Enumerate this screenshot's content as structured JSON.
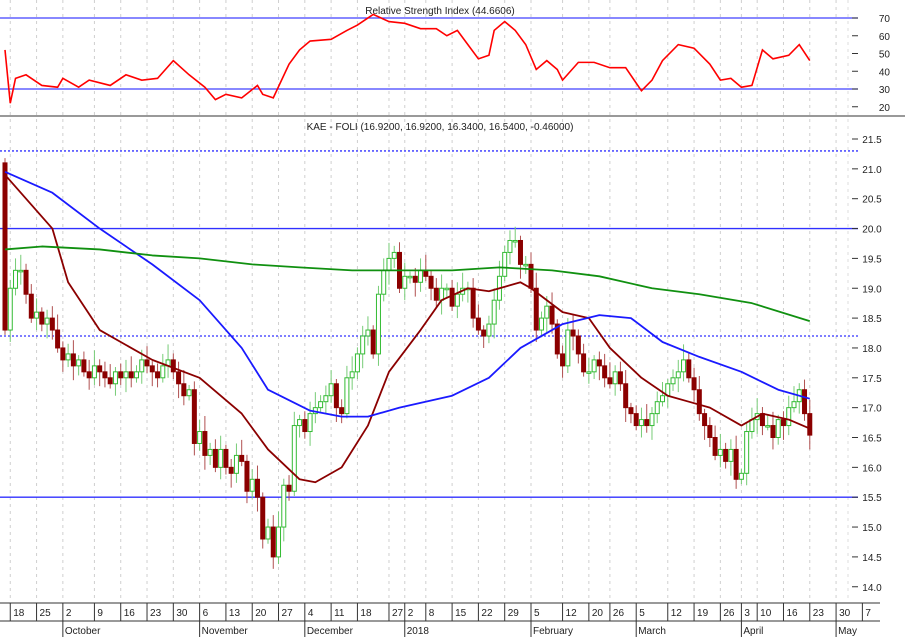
{
  "chart_data": {
    "type": "candlestick",
    "rsi_panel": {
      "title": "Relative Strength Index (44.6606)",
      "ylim": [
        15,
        78
      ],
      "ticks": [
        20,
        30,
        40,
        50,
        60,
        70
      ],
      "levels": [
        30,
        70
      ],
      "color": "#ff0000",
      "series": [
        [
          0,
          52
        ],
        [
          1,
          22
        ],
        [
          2,
          36
        ],
        [
          4,
          38
        ],
        [
          7,
          32
        ],
        [
          10,
          31
        ],
        [
          11,
          36
        ],
        [
          14,
          31
        ],
        [
          16,
          35
        ],
        [
          20,
          32
        ],
        [
          23,
          38
        ],
        [
          26,
          35
        ],
        [
          29,
          36
        ],
        [
          32,
          46
        ],
        [
          35,
          38
        ],
        [
          38,
          31
        ],
        [
          40,
          24
        ],
        [
          42,
          27
        ],
        [
          45,
          25
        ],
        [
          48,
          32
        ],
        [
          49,
          27
        ],
        [
          51,
          25
        ],
        [
          54,
          44
        ],
        [
          56,
          52
        ],
        [
          58,
          57
        ],
        [
          62,
          58
        ],
        [
          65,
          63
        ],
        [
          67,
          66
        ],
        [
          70,
          72
        ],
        [
          73,
          68
        ],
        [
          76,
          67
        ],
        [
          79,
          64
        ],
        [
          82,
          64
        ],
        [
          84,
          60
        ],
        [
          86,
          63
        ],
        [
          88,
          55
        ],
        [
          90,
          47
        ],
        [
          92,
          49
        ],
        [
          93,
          63
        ],
        [
          95,
          68
        ],
        [
          97,
          63
        ],
        [
          99,
          55
        ],
        [
          101,
          41
        ],
        [
          103,
          46
        ],
        [
          105,
          41
        ],
        [
          106,
          35
        ],
        [
          109,
          45
        ],
        [
          112,
          45
        ],
        [
          115,
          42
        ],
        [
          118,
          42
        ],
        [
          121,
          29
        ],
        [
          123,
          35
        ],
        [
          125,
          46
        ],
        [
          128,
          55
        ],
        [
          131,
          53
        ],
        [
          134,
          44
        ],
        [
          136,
          35
        ],
        [
          138,
          36
        ],
        [
          140,
          31
        ],
        [
          142,
          32
        ],
        [
          144,
          52
        ],
        [
          146,
          47
        ],
        [
          149,
          49
        ],
        [
          151,
          55
        ],
        [
          153,
          46
        ]
      ]
    },
    "price_panel": {
      "title": "KAE - FOLI (16.9200, 16.9200, 16.3400, 16.5400, -0.46000)",
      "ylim": [
        13.75,
        21.85
      ],
      "ticks": [
        "14.0",
        "14.5",
        "15.0",
        "15.5",
        "16.0",
        "16.5",
        "17.0",
        "17.5",
        "18.0",
        "18.5",
        "19.0",
        "19.5",
        "20.0",
        "20.5",
        "21.0",
        "21.5"
      ],
      "first_open": 21.1,
      "up_color": "#33bb33",
      "down_color": "#8b0000",
      "closes": [
        18.3,
        19.0,
        19.3,
        19.3,
        18.9,
        18.5,
        18.6,
        18.4,
        18.5,
        18.3,
        18.0,
        17.8,
        17.9,
        17.7,
        17.8,
        17.6,
        17.5,
        17.7,
        17.6,
        17.5,
        17.4,
        17.6,
        17.5,
        17.6,
        17.5,
        17.6,
        17.8,
        17.7,
        17.6,
        17.5,
        17.7,
        17.8,
        17.6,
        17.4,
        17.2,
        17.3,
        16.4,
        16.6,
        16.2,
        16.3,
        16.0,
        16.3,
        16.0,
        15.9,
        16.2,
        16.1,
        15.6,
        15.8,
        15.5,
        14.8,
        15.0,
        14.5,
        15.0,
        15.7,
        15.6,
        16.7,
        16.8,
        16.6,
        16.9,
        17.0,
        17.1,
        17.2,
        17.4,
        17.0,
        16.9,
        17.5,
        17.6,
        17.9,
        18.2,
        18.3,
        17.9,
        18.9,
        19.3,
        19.5,
        19.6,
        19.0,
        19.2,
        19.2,
        19.1,
        19.3,
        19.2,
        19.0,
        18.8,
        19.0,
        19.0,
        18.7,
        18.9,
        19.0,
        19.0,
        18.5,
        18.3,
        18.2,
        18.4,
        18.8,
        19.2,
        19.6,
        19.8,
        19.8,
        19.4,
        19.4,
        19.0,
        18.3,
        18.5,
        18.7,
        18.4,
        17.9,
        17.7,
        18.3,
        18.2,
        17.9,
        17.6,
        17.6,
        17.8,
        17.7,
        17.5,
        17.4,
        17.6,
        17.4,
        17.0,
        16.9,
        16.7,
        16.8,
        16.7,
        16.9,
        17.1,
        17.2,
        17.4,
        17.5,
        17.6,
        17.8,
        17.5,
        17.3,
        16.9,
        16.7,
        16.5,
        16.2,
        16.3,
        16.1,
        16.3,
        15.8,
        15.9,
        16.6,
        16.8,
        16.9,
        16.7,
        16.7,
        16.5,
        16.8,
        16.7,
        17.0,
        17.1,
        17.3,
        16.9,
        16.54
      ],
      "levels": [
        {
          "value": 21.3,
          "style": "dotted"
        },
        {
          "value": 20.0,
          "style": "solid"
        },
        {
          "value": 18.2,
          "style": "dotted"
        },
        {
          "value": 15.5,
          "style": "solid"
        }
      ],
      "moving_averages": [
        {
          "name": "short-ma",
          "color": "#8b0000",
          "points": [
            [
              0,
              20.9
            ],
            [
              9,
              20.0
            ],
            [
              12,
              19.1
            ],
            [
              18,
              18.3
            ],
            [
              22,
              18.1
            ],
            [
              28,
              17.8
            ],
            [
              37,
              17.5
            ],
            [
              45,
              16.9
            ],
            [
              50,
              16.3
            ],
            [
              56,
              15.8
            ],
            [
              59,
              15.75
            ],
            [
              64,
              16.0
            ],
            [
              69,
              16.7
            ],
            [
              73,
              17.6
            ],
            [
              79,
              18.3
            ],
            [
              83,
              18.8
            ],
            [
              88,
              19.0
            ],
            [
              92,
              18.95
            ],
            [
              98,
              19.1
            ],
            [
              100,
              19.0
            ],
            [
              106,
              18.6
            ],
            [
              111,
              18.5
            ],
            [
              115,
              18.0
            ],
            [
              121,
              17.5
            ],
            [
              126,
              17.2
            ],
            [
              130,
              17.1
            ],
            [
              134,
              17.0
            ],
            [
              140,
              16.7
            ],
            [
              144,
              16.9
            ],
            [
              149,
              16.8
            ],
            [
              153,
              16.65
            ]
          ]
        },
        {
          "name": "medium-ma",
          "color": "#1a1aff",
          "points": [
            [
              0,
              20.95
            ],
            [
              9,
              20.6
            ],
            [
              18,
              20.0
            ],
            [
              28,
              19.4
            ],
            [
              37,
              18.8
            ],
            [
              45,
              18.0
            ],
            [
              50,
              17.3
            ],
            [
              58,
              16.95
            ],
            [
              64,
              16.85
            ],
            [
              69,
              16.85
            ],
            [
              75,
              17.0
            ],
            [
              85,
              17.2
            ],
            [
              92,
              17.5
            ],
            [
              98,
              18.0
            ],
            [
              106,
              18.4
            ],
            [
              113,
              18.55
            ],
            [
              119,
              18.5
            ],
            [
              125,
              18.1
            ],
            [
              132,
              17.85
            ],
            [
              140,
              17.6
            ],
            [
              147,
              17.3
            ],
            [
              153,
              17.15
            ]
          ]
        },
        {
          "name": "long-ma",
          "color": "#109010",
          "points": [
            [
              0,
              19.65
            ],
            [
              7,
              19.7
            ],
            [
              18,
              19.65
            ],
            [
              28,
              19.55
            ],
            [
              37,
              19.5
            ],
            [
              47,
              19.4
            ],
            [
              56,
              19.35
            ],
            [
              66,
              19.3
            ],
            [
              75,
              19.3
            ],
            [
              85,
              19.3
            ],
            [
              94,
              19.35
            ],
            [
              104,
              19.3
            ],
            [
              113,
              19.2
            ],
            [
              123,
              19.0
            ],
            [
              132,
              18.9
            ],
            [
              142,
              18.75
            ],
            [
              153,
              18.45
            ]
          ]
        }
      ]
    },
    "x_axis": {
      "day_ticks": [
        [
          1,
          "18"
        ],
        [
          6,
          "25"
        ],
        [
          11,
          "2"
        ],
        [
          17,
          "9"
        ],
        [
          22,
          "16"
        ],
        [
          27,
          "23"
        ],
        [
          32,
          "30"
        ],
        [
          37,
          "6"
        ],
        [
          42,
          "13"
        ],
        [
          47,
          "20"
        ],
        [
          52,
          "27"
        ],
        [
          57,
          "4"
        ],
        [
          62,
          "11"
        ],
        [
          67,
          "18"
        ],
        [
          73,
          "27"
        ],
        [
          76,
          "2"
        ],
        [
          80,
          "8"
        ],
        [
          85,
          "15"
        ],
        [
          90,
          "22"
        ],
        [
          95,
          "29"
        ],
        [
          100,
          "5"
        ],
        [
          106,
          "12"
        ],
        [
          111,
          "20"
        ],
        [
          115,
          "26"
        ],
        [
          120,
          "5"
        ],
        [
          126,
          "12"
        ],
        [
          131,
          "19"
        ],
        [
          136,
          "26"
        ],
        [
          140,
          "3"
        ],
        [
          143,
          "10"
        ],
        [
          148,
          "16"
        ],
        [
          153,
          "23"
        ],
        [
          158,
          "30"
        ],
        [
          163,
          "7"
        ]
      ],
      "month_labels": [
        [
          11,
          "October"
        ],
        [
          37,
          "November"
        ],
        [
          57,
          "December"
        ],
        [
          76,
          "2018"
        ],
        [
          100,
          "February"
        ],
        [
          120,
          "March"
        ],
        [
          140,
          "April"
        ],
        [
          158,
          "May"
        ]
      ]
    }
  }
}
